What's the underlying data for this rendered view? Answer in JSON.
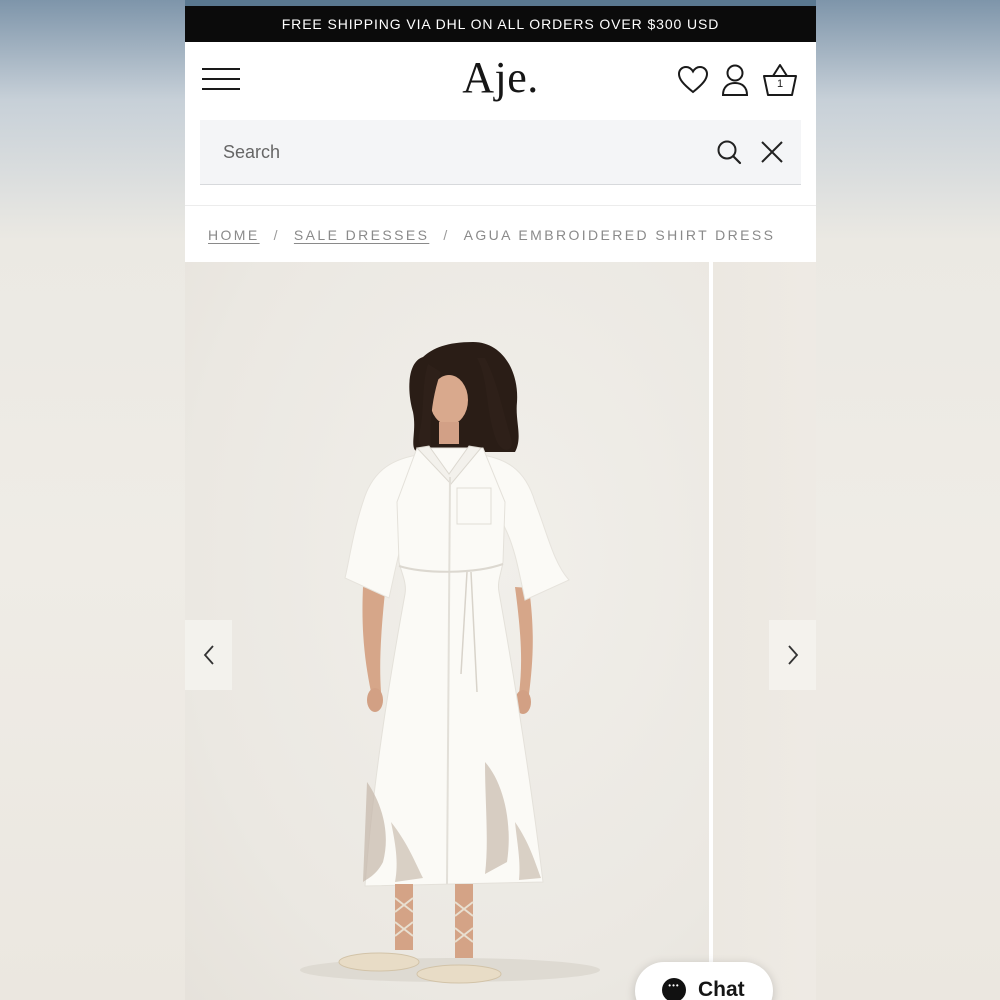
{
  "promo": {
    "text": "FREE SHIPPING VIA DHL ON ALL ORDERS OVER $300 USD"
  },
  "header": {
    "logo": "Aje.",
    "icons": {
      "menu": "hamburger-icon",
      "wishlist": "heart-icon",
      "account": "user-icon",
      "cart": "basket-icon"
    },
    "cart_count": "1"
  },
  "search": {
    "placeholder": "Search",
    "value": "",
    "icons": {
      "search": "search-icon",
      "close": "close-icon"
    }
  },
  "breadcrumb": {
    "items": [
      {
        "label": "HOME"
      },
      {
        "label": "SALE DRESSES"
      },
      {
        "label": "AGUA EMBROIDERED SHIRT DRESS"
      }
    ],
    "separator": "/"
  },
  "gallery": {
    "prev_icon": "chevron-left-icon",
    "next_icon": "chevron-right-icon"
  },
  "chat": {
    "label": "Chat",
    "icon": "chat-bubble-icon"
  },
  "colors": {
    "promo_bg": "#0b0b0b",
    "search_bg": "#f4f5f7",
    "breadcrumb_text": "#8a8a8a",
    "gallery_bg": "#ebe8e2",
    "dress": "#fbfaf6"
  }
}
